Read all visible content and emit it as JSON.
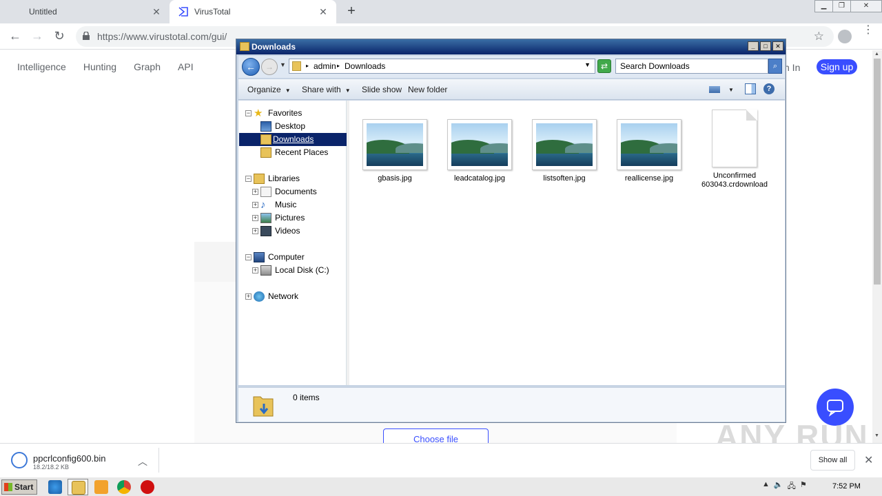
{
  "browser": {
    "tabs": [
      {
        "title": "Untitled",
        "active": false
      },
      {
        "title": "VirusTotal",
        "active": true
      }
    ],
    "url": "https://www.virustotal.com/gui/",
    "new_tab_symbol": "+",
    "close_symbol": "✕"
  },
  "virustotal": {
    "nav": [
      "Intelligence",
      "Hunting",
      "Graph",
      "API"
    ],
    "sign_in_partial": "n In",
    "sign_up": "Sign up",
    "choose_file": "Choose file",
    "brand_color": "#394eff"
  },
  "explorer": {
    "title": "Downloads",
    "breadcrumb": [
      "admin",
      "Downloads"
    ],
    "search_placeholder": "Search Downloads",
    "commands": [
      "Organize",
      "Share with",
      "Slide show",
      "New folder"
    ],
    "nav_tree": [
      {
        "label": "Favorites",
        "icon": "star-icon",
        "expander": "−",
        "level": 0
      },
      {
        "label": "Desktop",
        "icon": "desktop-icon",
        "expander": "",
        "level": 1
      },
      {
        "label": "Downloads",
        "icon": "downloads-folder-icon",
        "expander": "",
        "level": 1,
        "selected": true
      },
      {
        "label": "Recent Places",
        "icon": "recent-places-icon",
        "expander": "",
        "level": 1
      },
      {
        "label": "Libraries",
        "icon": "libraries-icon",
        "expander": "−",
        "level": 0
      },
      {
        "label": "Documents",
        "icon": "documents-icon",
        "expander": "+",
        "level": 1
      },
      {
        "label": "Music",
        "icon": "music-icon",
        "expander": "+",
        "level": 1
      },
      {
        "label": "Pictures",
        "icon": "pictures-icon",
        "expander": "+",
        "level": 1
      },
      {
        "label": "Videos",
        "icon": "videos-icon",
        "expander": "+",
        "level": 1
      },
      {
        "label": "Computer",
        "icon": "computer-icon",
        "expander": "−",
        "level": 0
      },
      {
        "label": "Local Disk (C:)",
        "icon": "local-disk-icon",
        "expander": "+",
        "level": 1
      },
      {
        "label": "Network",
        "icon": "network-icon",
        "expander": "+",
        "level": 0
      }
    ],
    "files": [
      {
        "name": "gbasis.jpg",
        "kind": "image"
      },
      {
        "name": "leadcatalog.jpg",
        "kind": "image"
      },
      {
        "name": "listsoften.jpg",
        "kind": "image"
      },
      {
        "name": "reallicense.jpg",
        "kind": "image"
      },
      {
        "name": "Unconfirmed 603043.crdownload",
        "kind": "document"
      }
    ],
    "status": "0 items",
    "title_bar_color": "#0a246a",
    "selection_color": "#0a246a"
  },
  "downloads_bar": {
    "file_name": "ppcrlconfig600.bin",
    "file_size": "18.2/18.2 KB",
    "show_all": "Show all"
  },
  "taskbar": {
    "start": "Start",
    "clock": "7:52 PM"
  },
  "watermark": "ANY RUN"
}
